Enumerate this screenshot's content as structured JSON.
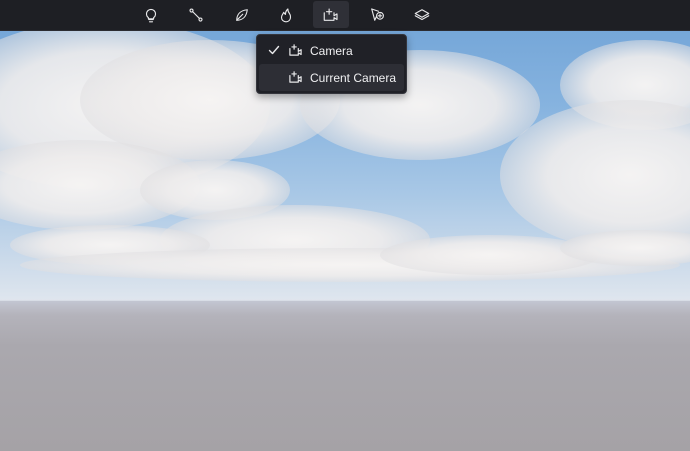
{
  "toolbar": {
    "tools": [
      {
        "name": "light",
        "icon": "lightbulb-icon",
        "active": false
      },
      {
        "name": "path",
        "icon": "path-nodes-icon",
        "active": false
      },
      {
        "name": "foliage",
        "icon": "leaf-icon",
        "active": false
      },
      {
        "name": "fire",
        "icon": "flame-icon",
        "active": false
      },
      {
        "name": "add-camera",
        "icon": "camera-add-icon",
        "active": true
      },
      {
        "name": "add-marker",
        "icon": "cursor-add-icon",
        "active": false
      },
      {
        "name": "layers",
        "icon": "layers-icon",
        "active": false
      }
    ]
  },
  "camera_menu": {
    "items": [
      {
        "label": "Camera",
        "icon": "camera-add-icon",
        "checked": true,
        "hovered": false
      },
      {
        "label": "Current Camera",
        "icon": "camera-add-icon",
        "checked": false,
        "hovered": true
      }
    ]
  },
  "colors": {
    "toolbar_bg": "#1e1f24",
    "menu_bg": "#202127",
    "menu_hover": "#2d2e35",
    "icon": "#e8e8ea"
  }
}
